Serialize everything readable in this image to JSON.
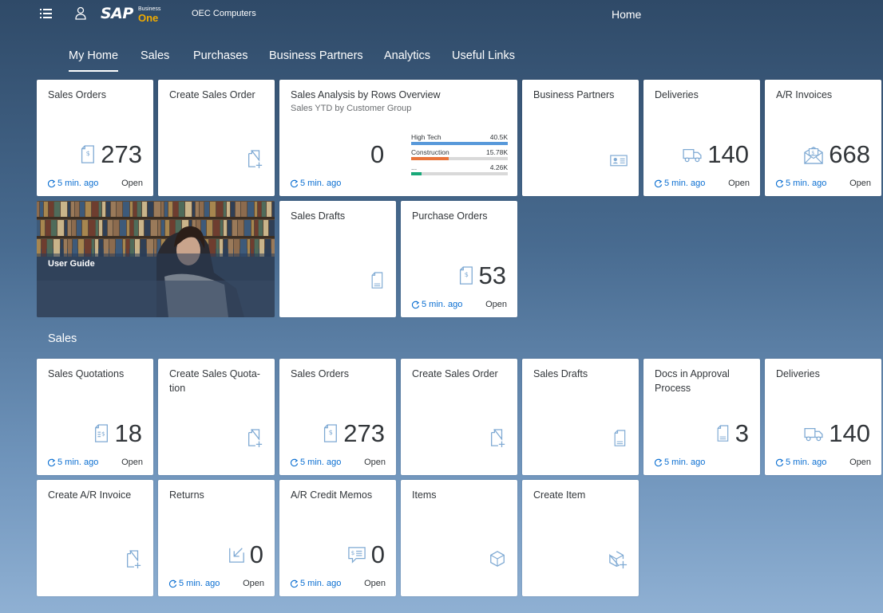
{
  "shell": {
    "company": "OEC Computers",
    "title": "Home",
    "logo_sap": "SAP",
    "logo_business": "Business",
    "logo_one": "One"
  },
  "tabs": [
    {
      "label": "My Home",
      "active": true
    },
    {
      "label": "Sales"
    },
    {
      "label": "Purchases"
    },
    {
      "label": "Business Partners"
    },
    {
      "label": "Analytics"
    },
    {
      "label": "Useful Links"
    }
  ],
  "common": {
    "refresh": "5 min. ago",
    "open": "Open"
  },
  "home": {
    "sales_orders": {
      "title": "Sales Orders",
      "value": "273",
      "icon": "document-dollar-icon"
    },
    "create_sales_order": {
      "title": "Create Sales Order",
      "icon": "document-add-icon"
    },
    "sales_analysis": {
      "title": "Sales Analysis by Rows Overview",
      "subtitle": "Sales YTD by Customer Group",
      "value": "0",
      "rows": [
        {
          "label": "High Tech",
          "value": "40.5K",
          "fraction": 1.0,
          "color": "#5899da"
        },
        {
          "label": "Construction",
          "value": "15.78K",
          "fraction": 0.39,
          "color": "#e8743b"
        },
        {
          "label": "...",
          "value": "4.26K",
          "fraction": 0.105,
          "color": "#19a979"
        }
      ]
    },
    "business_partners": {
      "title": "Business Partners",
      "icon": "business-card-icon"
    },
    "deliveries": {
      "title": "Deliveries",
      "value": "140",
      "icon": "truck-icon"
    },
    "ar_invoices": {
      "title": "A/R Invoices",
      "value": "668",
      "icon": "invoice-envelope-icon"
    },
    "user_guide": {
      "caption": "User Guide"
    },
    "sales_drafts": {
      "title": "Sales Drafts",
      "icon": "document-draft-icon"
    },
    "purchase_orders": {
      "title": "Purchase Orders",
      "value": "53",
      "icon": "document-dollar-icon"
    }
  },
  "sales_section": {
    "title": "Sales",
    "sales_quotations": {
      "title": "Sales Quotations",
      "value": "18",
      "icon": "quotation-icon"
    },
    "create_sales_quotation": {
      "title": "Create Sales Quota-tion",
      "icon": "document-add-icon"
    },
    "sales_orders": {
      "title": "Sales Orders",
      "value": "273",
      "icon": "document-dollar-icon"
    },
    "create_sales_order": {
      "title": "Create Sales Order",
      "icon": "document-add-icon"
    },
    "sales_drafts": {
      "title": "Sales Drafts",
      "icon": "document-draft-icon"
    },
    "docs_in_approval": {
      "title": "Docs in Approval Process",
      "value": "3",
      "icon": "document-draft-icon"
    },
    "deliveries": {
      "title": "Deliveries",
      "value": "140",
      "icon": "truck-icon"
    },
    "create_ar_invoice": {
      "title": "Create A/R Invoice",
      "icon": "document-add-icon"
    },
    "returns": {
      "title": "Returns",
      "value": "0",
      "icon": "return-icon"
    },
    "ar_credit_memos": {
      "title": "A/R Credit Memos",
      "value": "0",
      "icon": "credit-memo-icon"
    },
    "items": {
      "title": "Items",
      "icon": "box-icon"
    },
    "create_item": {
      "title": "Create Item",
      "icon": "box-add-icon"
    }
  }
}
